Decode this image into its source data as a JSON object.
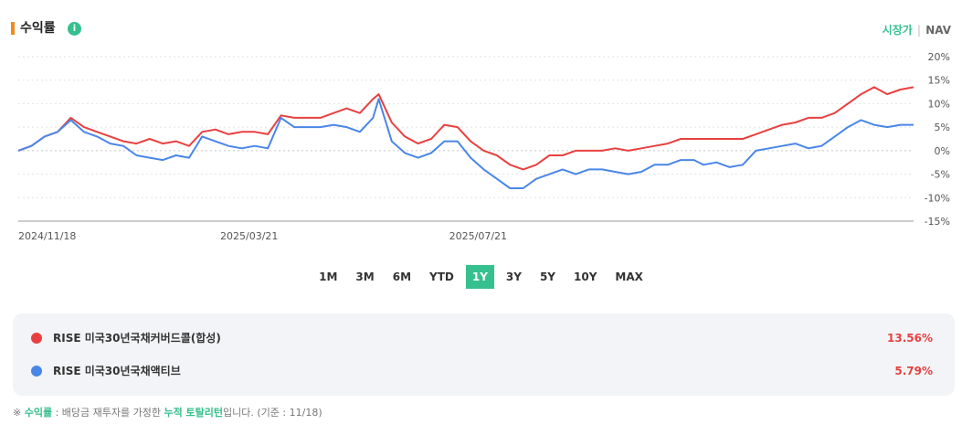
{
  "header": {
    "title": "수익률",
    "info_glyph": "i",
    "toggle_price": "시장가",
    "toggle_nav": "NAV"
  },
  "periods": [
    "1M",
    "3M",
    "6M",
    "YTD",
    "1Y",
    "3Y",
    "5Y",
    "10Y",
    "MAX"
  ],
  "active_period": "1Y",
  "colors": {
    "accent": "#36c08f",
    "series_red": "#e84040",
    "series_blue": "#4a86e8",
    "title_marker": "#f08a1c"
  },
  "legend": [
    {
      "name": "RISE 미국30년국채커버드콜(합성)",
      "value": "13.56%",
      "color": "#e84040"
    },
    {
      "name": "RISE 미국30년국채액티브",
      "value": "5.79%",
      "color": "#4a86e8"
    }
  ],
  "footnote": {
    "prefix": "※ ",
    "term": "수익률",
    "middle": " : 배당금 재투자를 가정한 ",
    "term2": "누적 토탈리턴",
    "suffix": "입니다. (기준 : 11/18)"
  },
  "chart_data": {
    "type": "line",
    "x_ticks": [
      "2024/11/18",
      "2025/03/21",
      "2025/07/21"
    ],
    "y_ticks": [
      "20%",
      "15%",
      "10%",
      "5%",
      "0%",
      "-5%",
      "-10%",
      "-15%"
    ],
    "ylim": [
      -15,
      20
    ],
    "grid": true,
    "x_start": "2024/11/18",
    "x_end": "2025/11/18",
    "series": [
      {
        "name": "RISE 미국30년국채커버드콜(합성)",
        "color": "#e84040",
        "points": [
          [
            "2024/11/18",
            0
          ],
          [
            "2024/11/25",
            1
          ],
          [
            "2024/12/02",
            3
          ],
          [
            "2024/12/09",
            4
          ],
          [
            "2024/12/16",
            7
          ],
          [
            "2024/12/23",
            5
          ],
          [
            "2024/12/30",
            4
          ],
          [
            "2025/01/06",
            3
          ],
          [
            "2025/01/13",
            2
          ],
          [
            "2025/01/20",
            1.5
          ],
          [
            "2025/01/27",
            2.5
          ],
          [
            "2025/02/03",
            1.5
          ],
          [
            "2025/02/10",
            2
          ],
          [
            "2025/02/17",
            1
          ],
          [
            "2025/02/24",
            4
          ],
          [
            "2025/03/03",
            4.5
          ],
          [
            "2025/03/10",
            3.5
          ],
          [
            "2025/03/17",
            4
          ],
          [
            "2025/03/24",
            4
          ],
          [
            "2025/03/31",
            3.5
          ],
          [
            "2025/04/07",
            7.5
          ],
          [
            "2025/04/14",
            7
          ],
          [
            "2025/04/21",
            7
          ],
          [
            "2025/04/28",
            7
          ],
          [
            "2025/05/05",
            8
          ],
          [
            "2025/05/12",
            9
          ],
          [
            "2025/05/19",
            8
          ],
          [
            "2025/05/26",
            11
          ],
          [
            "2025/05/29",
            12
          ],
          [
            "2025/06/05",
            6
          ],
          [
            "2025/06/12",
            3
          ],
          [
            "2025/06/19",
            1.5
          ],
          [
            "2025/06/26",
            2.5
          ],
          [
            "2025/07/03",
            5.5
          ],
          [
            "2025/07/10",
            5
          ],
          [
            "2025/07/17",
            2
          ],
          [
            "2025/07/24",
            0
          ],
          [
            "2025/07/31",
            -1
          ],
          [
            "2025/08/07",
            -3
          ],
          [
            "2025/08/14",
            -4
          ],
          [
            "2025/08/21",
            -3
          ],
          [
            "2025/08/28",
            -1
          ],
          [
            "2025/09/04",
            -1
          ],
          [
            "2025/09/11",
            0
          ],
          [
            "2025/09/18",
            0
          ],
          [
            "2025/09/25",
            0
          ],
          [
            "2025/10/02",
            0.5
          ],
          [
            "2025/10/09",
            0
          ],
          [
            "2025/10/16",
            0.5
          ],
          [
            "2025/10/23",
            1
          ],
          [
            "2025/10/30",
            1.5
          ],
          [
            "2025/11/06",
            2.5
          ],
          [
            "2025/11/13",
            2.5
          ],
          [
            "2025/11/18",
            2.5
          ],
          [
            "2025/11/25",
            2.5
          ],
          [
            "2025/12/02",
            2.5
          ],
          [
            "2025/12/09",
            2.5
          ],
          [
            "2025/12/16",
            3.5
          ],
          [
            "2025/12/23",
            4.5
          ],
          [
            "2025/12/30",
            5.5
          ],
          [
            "2026/01/06",
            6
          ],
          [
            "2026/01/13",
            7
          ],
          [
            "2026/01/20",
            7
          ],
          [
            "2026/01/27",
            8
          ],
          [
            "2026/02/03",
            10
          ],
          [
            "2026/02/10",
            12
          ],
          [
            "2026/02/17",
            13.5
          ],
          [
            "2026/02/24",
            12
          ],
          [
            "2026/03/03",
            13
          ],
          [
            "2026/03/10",
            13.5
          ]
        ]
      },
      {
        "name": "RISE 미국30년국채액티브",
        "color": "#4a86e8",
        "points": [
          [
            "2024/11/18",
            0
          ],
          [
            "2024/11/25",
            1
          ],
          [
            "2024/12/02",
            3
          ],
          [
            "2024/12/09",
            4
          ],
          [
            "2024/12/16",
            6.5
          ],
          [
            "2024/12/23",
            4
          ],
          [
            "2024/12/30",
            3
          ],
          [
            "2025/01/06",
            1.5
          ],
          [
            "2025/01/13",
            1
          ],
          [
            "2025/01/20",
            -1
          ],
          [
            "2025/01/27",
            -1.5
          ],
          [
            "2025/02/03",
            -2
          ],
          [
            "2025/02/10",
            -1
          ],
          [
            "2025/02/17",
            -1.5
          ],
          [
            "2025/02/24",
            3
          ],
          [
            "2025/03/03",
            2
          ],
          [
            "2025/03/10",
            1
          ],
          [
            "2025/03/17",
            0.5
          ],
          [
            "2025/03/24",
            1
          ],
          [
            "2025/03/31",
            0.5
          ],
          [
            "2025/04/07",
            7
          ],
          [
            "2025/04/14",
            5
          ],
          [
            "2025/04/21",
            5
          ],
          [
            "2025/04/28",
            5
          ],
          [
            "2025/05/05",
            5.5
          ],
          [
            "2025/05/12",
            5
          ],
          [
            "2025/05/19",
            4
          ],
          [
            "2025/05/26",
            7
          ],
          [
            "2025/05/29",
            11
          ],
          [
            "2025/06/05",
            2
          ],
          [
            "2025/06/12",
            -0.5
          ],
          [
            "2025/06/19",
            -1.5
          ],
          [
            "2025/06/26",
            -0.5
          ],
          [
            "2025/07/03",
            2
          ],
          [
            "2025/07/10",
            2
          ],
          [
            "2025/07/17",
            -1.5
          ],
          [
            "2025/07/24",
            -4
          ],
          [
            "2025/07/31",
            -6
          ],
          [
            "2025/08/07",
            -8
          ],
          [
            "2025/08/14",
            -8
          ],
          [
            "2025/08/21",
            -6
          ],
          [
            "2025/08/28",
            -5
          ],
          [
            "2025/09/04",
            -4
          ],
          [
            "2025/09/11",
            -5
          ],
          [
            "2025/09/18",
            -4
          ],
          [
            "2025/09/25",
            -4
          ],
          [
            "2025/10/02",
            -4.5
          ],
          [
            "2025/10/09",
            -5
          ],
          [
            "2025/10/16",
            -4.5
          ],
          [
            "2025/10/23",
            -3
          ],
          [
            "2025/10/30",
            -3
          ],
          [
            "2025/11/06",
            -2
          ],
          [
            "2025/11/13",
            -2
          ],
          [
            "2025/11/18",
            -3
          ],
          [
            "2025/11/25",
            -2.5
          ],
          [
            "2025/12/02",
            -3.5
          ],
          [
            "2025/12/09",
            -3
          ],
          [
            "2025/12/16",
            0
          ],
          [
            "2025/12/23",
            0.5
          ],
          [
            "2025/12/30",
            1
          ],
          [
            "2026/01/06",
            1.5
          ],
          [
            "2026/01/13",
            0.5
          ],
          [
            "2026/01/20",
            1
          ],
          [
            "2026/01/27",
            3
          ],
          [
            "2026/02/03",
            5
          ],
          [
            "2026/02/10",
            6.5
          ],
          [
            "2026/02/17",
            5.5
          ],
          [
            "2026/02/24",
            5
          ],
          [
            "2026/03/03",
            5.5
          ],
          [
            "2026/03/10",
            5.5
          ]
        ]
      }
    ]
  }
}
